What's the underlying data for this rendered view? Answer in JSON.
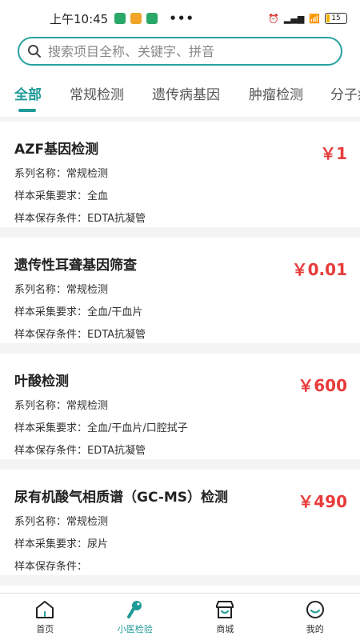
{
  "status_bar": {
    "time": "上午10:45",
    "battery": "15"
  },
  "search": {
    "placeholder": "搜索项目全称、关键字、拼音"
  },
  "tabs": [
    {
      "label": "全部",
      "active": true
    },
    {
      "label": "常规检测"
    },
    {
      "label": "遗传病基因"
    },
    {
      "label": "肿瘤检测"
    },
    {
      "label": "分子病"
    }
  ],
  "products": [
    {
      "name": "AZF基因检测",
      "price": "￥1",
      "series": "系列名称：常规检测",
      "sample": "样本采集要求：全血",
      "storage": "样本保存条件：EDTA抗凝管"
    },
    {
      "name": "遗传性耳聋基因筛查",
      "price": "￥0.01",
      "series": "系列名称：常规检测",
      "sample": "样本采集要求：全血/干血片",
      "storage": "样本保存条件：EDTA抗凝管"
    },
    {
      "name": "叶酸检测",
      "price": "￥600",
      "series": "系列名称：常规检测",
      "sample": "样本采集要求：全血/干血片/口腔拭子",
      "storage": "样本保存条件：EDTA抗凝管"
    },
    {
      "name": "尿有机酸气相质谱（GC-MS）检测",
      "price": "￥490",
      "series": "系列名称：常规检测",
      "sample": "样本采集要求：尿片",
      "storage": "样本保存条件："
    }
  ],
  "bottom_nav": [
    {
      "label": "首页",
      "icon": "home-icon"
    },
    {
      "label": "小医检验",
      "icon": "test-icon",
      "active": true
    },
    {
      "label": "商城",
      "icon": "shop-icon"
    },
    {
      "label": "我的",
      "icon": "profile-icon"
    }
  ],
  "colors": {
    "accent": "#1e9a98",
    "price": "#e83b3b"
  }
}
